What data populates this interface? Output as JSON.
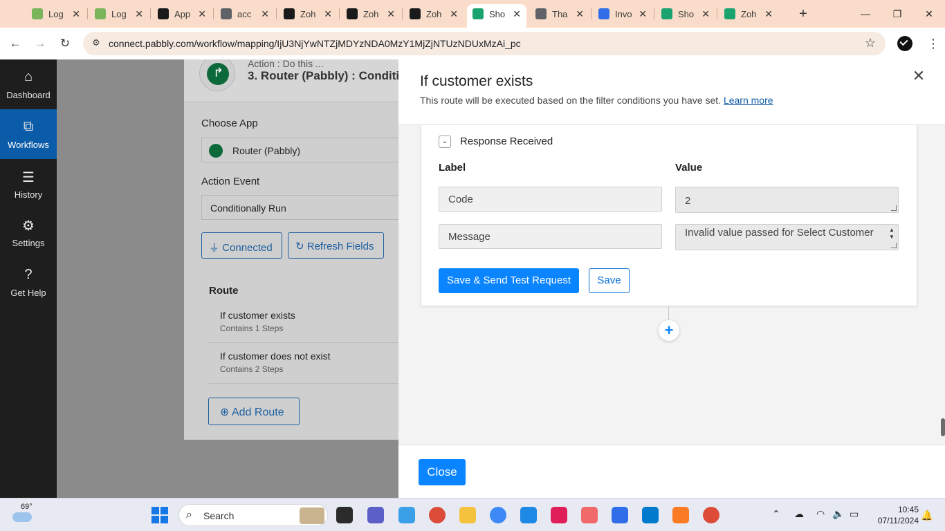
{
  "browser": {
    "tabs": [
      {
        "title": "Log",
        "favicon": "shopify-icon",
        "color": "#7ab55c"
      },
      {
        "title": "Log",
        "favicon": "shopify-icon",
        "color": "#7ab55c"
      },
      {
        "title": "App",
        "favicon": "shopify-dark-icon",
        "color": "#1a1a1a"
      },
      {
        "title": "acc",
        "favicon": "globe-icon",
        "color": "#5f6368"
      },
      {
        "title": "Zoh",
        "favicon": "shopify-dark-icon",
        "color": "#1a1a1a"
      },
      {
        "title": "Zoh",
        "favicon": "shopify-dark-icon",
        "color": "#1a1a1a"
      },
      {
        "title": "Zoh",
        "favicon": "shopify-dark-icon",
        "color": "#1a1a1a"
      },
      {
        "title": "Sho",
        "favicon": "pabbly-icon",
        "color": "#1aa36f",
        "active": true
      },
      {
        "title": "Tha",
        "favicon": "globe-icon",
        "color": "#5f6368"
      },
      {
        "title": "Invo",
        "favicon": "zoho-invoice-icon",
        "color": "#2f6ee8"
      },
      {
        "title": "Sho",
        "favicon": "pabbly-icon",
        "color": "#1aa36f"
      },
      {
        "title": "Zoh",
        "favicon": "pabbly-icon",
        "color": "#1aa36f"
      }
    ],
    "url": "connect.pabbly.com/workflow/mapping/IjU3NjYwNTZjMDYzNDA0MzY1MjZjNTUzNDUxMzAi_pc"
  },
  "sidebar": {
    "items": [
      {
        "label": "Dashboard",
        "icon": "home-icon"
      },
      {
        "label": "Workflows",
        "icon": "workflow-icon",
        "active": true
      },
      {
        "label": "History",
        "icon": "list-icon"
      },
      {
        "label": "Settings",
        "icon": "gear-icon"
      },
      {
        "label": "Get Help",
        "icon": "help-icon"
      }
    ]
  },
  "background": {
    "action_label": "Action : Do this ...",
    "step_title": "3. Router (Pabbly) : Conditi",
    "choose_app_label": "Choose App",
    "app_value": "Router (Pabbly)",
    "action_event_label": "Action Event",
    "action_event_value": "Conditionally Run",
    "connected_label": "Connected",
    "refresh_label": "Refresh Fields",
    "route_title": "Route",
    "routes": [
      {
        "name": "If customer exists",
        "steps": "Contains 1 Steps"
      },
      {
        "name": "If customer does not exist",
        "steps": "Contains 2 Steps"
      }
    ],
    "add_route_label": "Add Route"
  },
  "modal": {
    "title": "If customer exists",
    "description": "This route will be executed based on the filter conditions you have set.",
    "learn_more": "Learn more",
    "response_title": "Response Received",
    "label_header": "Label",
    "value_header": "Value",
    "rows": [
      {
        "label": "Code",
        "value": "2"
      },
      {
        "label": "Message",
        "value": "Invalid value passed for Select Customer"
      }
    ],
    "save_send_label": "Save & Send Test Request",
    "save_label": "Save",
    "close_label": "Close"
  },
  "taskbar": {
    "temperature": "69°",
    "search_label": "Search",
    "time": "10:45",
    "date": "07/11/2024"
  },
  "colors": {
    "accent": "#0a84ff",
    "sidebar_active": "#0b5ca8",
    "pabbly_green": "#0c6a3a"
  }
}
